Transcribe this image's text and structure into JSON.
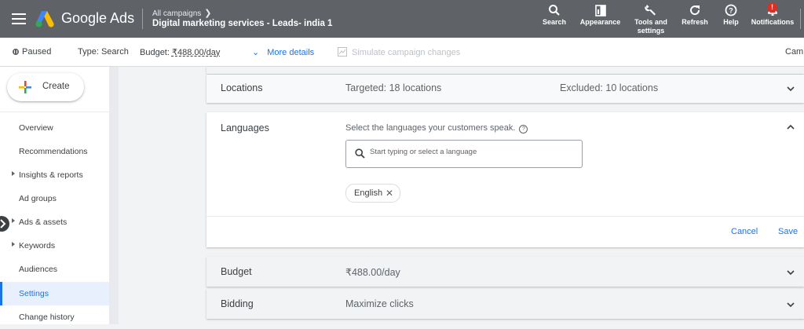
{
  "header": {
    "brand": "Google Ads",
    "breadcrumb": "All campaigns",
    "campaign_title": "Digital marketing services - Leads- india 1",
    "tools": [
      {
        "label_1": "Search",
        "label_2": "",
        "icon": "search-icon"
      },
      {
        "label_1": "Appearance",
        "label_2": "",
        "icon": "appearance-icon"
      },
      {
        "label_1": "Tools and",
        "label_2": "settings",
        "icon": "wrench-icon"
      },
      {
        "label_1": "Refresh",
        "label_2": "",
        "icon": "refresh-icon"
      },
      {
        "label_1": "Help",
        "label_2": "",
        "icon": "help-icon"
      },
      {
        "label_1": "Notifications",
        "label_2": "",
        "icon": "bell-icon",
        "badge": "!"
      }
    ]
  },
  "subbar": {
    "status": "Paused",
    "type": "Type: Search",
    "budget_label": "Budget: ",
    "budget_value": "₹488.00/day",
    "more_details": "More details",
    "simulate": "Simulate campaign changes",
    "right_cut": "Camp"
  },
  "sidebar": {
    "create_label": "Create",
    "items": [
      {
        "label": "Overview",
        "expandable": false,
        "active": false
      },
      {
        "label": "Recommendations",
        "expandable": false,
        "active": false
      },
      {
        "label": "Insights & reports",
        "expandable": true,
        "active": false
      },
      {
        "label": "Ad groups",
        "expandable": false,
        "active": false
      },
      {
        "label": "Ads & assets",
        "expandable": true,
        "active": false
      },
      {
        "label": "Keywords",
        "expandable": true,
        "active": false
      },
      {
        "label": "Audiences",
        "expandable": false,
        "active": false
      },
      {
        "label": "Settings",
        "expandable": false,
        "active": true
      },
      {
        "label": "Change history",
        "expandable": false,
        "active": false
      }
    ]
  },
  "settings": {
    "locations": {
      "label": "Locations",
      "targeted": "Targeted: 18 locations",
      "excluded": "Excluded: 10 locations"
    },
    "languages": {
      "label": "Languages",
      "description": "Select the languages your customers speak.",
      "search_placeholder": "Start typing or select a language",
      "selected": [
        "English"
      ],
      "cancel": "Cancel",
      "save": "Save"
    },
    "budget": {
      "label": "Budget",
      "value": "₹488.00/day"
    },
    "bidding": {
      "label": "Bidding",
      "value": "Maximize clicks"
    }
  },
  "colors": {
    "accent": "#1a73e8",
    "topbar": "#5f6368",
    "active_bg": "#e8f0fe"
  }
}
